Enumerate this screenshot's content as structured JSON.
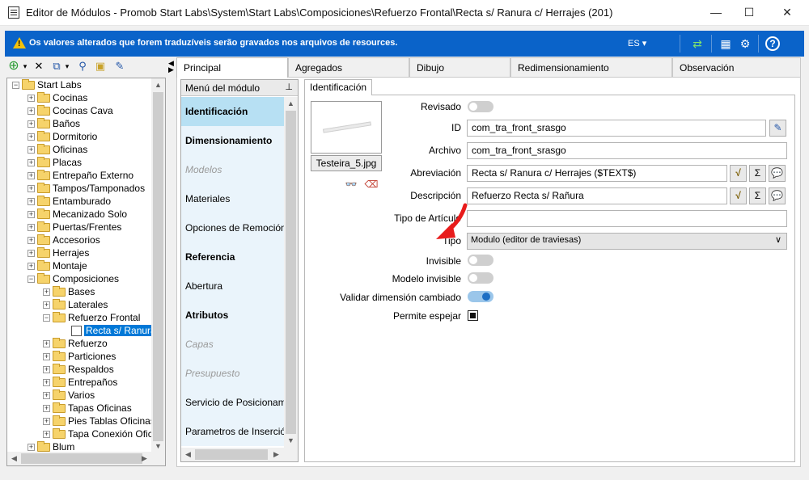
{
  "window": {
    "title": "Editor de Módulos - Promob Start Labs\\System\\Start Labs\\Composiciones\\Refuerzo Frontal\\Recta s/ Ranura c/ Herrajes (201)",
    "minimize": "—",
    "maximize": "☐",
    "close": "✕"
  },
  "banner": {
    "warning_icon": "!",
    "message": "Os valores alterados que forem traduzíveis serão gravados nos arquivos de resources.",
    "language": "ES ▾",
    "refresh_icon": "⇄",
    "layout_icon": "▦",
    "settings_icon": "⚙",
    "help_icon": "?",
    "color": "#0a63c9"
  },
  "tree_toolbar": {
    "add_icon": "⊕",
    "dropdown_icon": "▾",
    "delete_icon": "✕",
    "copy_icon": "⧉",
    "copy_dropdown_icon": "▾",
    "find_icon": "⚲",
    "folder_icon": "▣",
    "tool_icon": "✎"
  },
  "tree": {
    "root": "Start Labs",
    "items": [
      "Cocinas",
      "Cocinas Cava",
      "Baños",
      "Dormitorio",
      "Oficinas",
      "Placas",
      "Entrepaño Externo",
      "Tampos/Tamponados",
      "Entamburado",
      "Mecanizado Solo",
      "Puertas/Frentes",
      "Accesorios",
      "Herrajes",
      "Montaje"
    ],
    "composiciones": "Composiciones",
    "comp_children_top": [
      "Bases",
      "Laterales"
    ],
    "refuerzo_frontal": "Refuerzo Frontal",
    "selected": "Recta s/ Ranura",
    "comp_children_bottom": [
      "Refuerzo",
      "Particiones",
      "Respaldos",
      "Entrepaños",
      "Varios",
      "Tapas Oficinas",
      "Pies Tablas Oficinas",
      "Tapa Conexión Ofic"
    ],
    "blum": "Blum"
  },
  "tabs": [
    "Principal",
    "Agregados",
    "Dibujo",
    "Redimensionamiento",
    "Observación"
  ],
  "module_menu": {
    "header": "Menú del módulo",
    "pin_icon": "⊥",
    "items": [
      {
        "label": "Identificación",
        "bold": true,
        "disabled": false,
        "active": true
      },
      {
        "label": "Dimensionamiento",
        "bold": true,
        "disabled": false,
        "active": false
      },
      {
        "label": "Modelos",
        "bold": false,
        "disabled": true,
        "active": false
      },
      {
        "label": "Materiales",
        "bold": false,
        "disabled": false,
        "active": false
      },
      {
        "label": "Opciones de Remoción",
        "bold": false,
        "disabled": false,
        "active": false
      },
      {
        "label": "Referencia",
        "bold": true,
        "disabled": false,
        "active": false
      },
      {
        "label": "Abertura",
        "bold": false,
        "disabled": false,
        "active": false
      },
      {
        "label": "Atributos",
        "bold": true,
        "disabled": false,
        "active": false
      },
      {
        "label": "Capas",
        "bold": false,
        "disabled": true,
        "active": false
      },
      {
        "label": "Presupuesto",
        "bold": false,
        "disabled": true,
        "active": false
      },
      {
        "label": "Servicio de Posicionamiento",
        "bold": false,
        "disabled": false,
        "active": false
      },
      {
        "label": "Parametros de Inserción",
        "bold": false,
        "disabled": false,
        "active": false
      }
    ]
  },
  "identificacion": {
    "tab": "Identificación",
    "image_name": "Testeira_5.jpg",
    "search_image_icon": "👓",
    "clear_image_icon": "⌫",
    "fields": {
      "revisado": "Revisado",
      "id_label": "ID",
      "id_value": "com_tra_front_srasgo",
      "archivo_label": "Archivo",
      "archivo_value": "com_tra_front_srasgo",
      "abreviacion_label": "Abreviación",
      "abreviacion_value": "Recta s/ Ranura c/ Herrajes ($TEXT$)",
      "descripcion_label": "Descripción",
      "descripcion_value": "Refuerzo Recta s/ Rañura",
      "tipo_articulo_label": "Tipo de Artículo",
      "tipo_articulo_value": "",
      "tipo_label": "Tipo",
      "tipo_value": "Modulo (editor de traviesas)",
      "invisible_label": "Invisible",
      "modelo_invisible_label": "Modelo invisible",
      "validar_label": "Validar dimensión cambiado",
      "permite_label": "Permite espejar"
    },
    "states": {
      "revisado": false,
      "invisible": false,
      "modelo_invisible": false,
      "validar_dimension": true,
      "permite_espejar": true
    },
    "formula_icon": "√",
    "sigma_icon": "Σ",
    "comment_icon": "💬",
    "id_tool_icon": "✎"
  }
}
